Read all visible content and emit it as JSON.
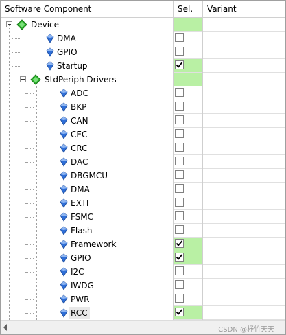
{
  "header": {
    "component": "Software Component",
    "sel": "Sel.",
    "variant": "Variant"
  },
  "rows": [
    {
      "label": "Device",
      "level": 0,
      "type": "group",
      "expander": true,
      "selGreen": true,
      "checkbox": false,
      "checked": false
    },
    {
      "label": "DMA",
      "level": 1,
      "type": "leaf",
      "selGreen": false,
      "checkbox": true,
      "checked": false
    },
    {
      "label": "GPIO",
      "level": 1,
      "type": "leaf",
      "selGreen": false,
      "checkbox": true,
      "checked": false
    },
    {
      "label": "Startup",
      "level": 1,
      "type": "leaf",
      "selGreen": true,
      "checkbox": true,
      "checked": true
    },
    {
      "label": "StdPeriph Drivers",
      "level": 1,
      "type": "group",
      "expander": true,
      "selGreen": true,
      "checkbox": false,
      "checked": false
    },
    {
      "label": "ADC",
      "level": 2,
      "type": "leaf",
      "selGreen": false,
      "checkbox": true,
      "checked": false
    },
    {
      "label": "BKP",
      "level": 2,
      "type": "leaf",
      "selGreen": false,
      "checkbox": true,
      "checked": false
    },
    {
      "label": "CAN",
      "level": 2,
      "type": "leaf",
      "selGreen": false,
      "checkbox": true,
      "checked": false
    },
    {
      "label": "CEC",
      "level": 2,
      "type": "leaf",
      "selGreen": false,
      "checkbox": true,
      "checked": false
    },
    {
      "label": "CRC",
      "level": 2,
      "type": "leaf",
      "selGreen": false,
      "checkbox": true,
      "checked": false
    },
    {
      "label": "DAC",
      "level": 2,
      "type": "leaf",
      "selGreen": false,
      "checkbox": true,
      "checked": false
    },
    {
      "label": "DBGMCU",
      "level": 2,
      "type": "leaf",
      "selGreen": false,
      "checkbox": true,
      "checked": false
    },
    {
      "label": "DMA",
      "level": 2,
      "type": "leaf",
      "selGreen": false,
      "checkbox": true,
      "checked": false
    },
    {
      "label": "EXTI",
      "level": 2,
      "type": "leaf",
      "selGreen": false,
      "checkbox": true,
      "checked": false
    },
    {
      "label": "FSMC",
      "level": 2,
      "type": "leaf",
      "selGreen": false,
      "checkbox": true,
      "checked": false
    },
    {
      "label": "Flash",
      "level": 2,
      "type": "leaf",
      "selGreen": false,
      "checkbox": true,
      "checked": false
    },
    {
      "label": "Framework",
      "level": 2,
      "type": "leaf",
      "selGreen": true,
      "checkbox": true,
      "checked": true
    },
    {
      "label": "GPIO",
      "level": 2,
      "type": "leaf",
      "selGreen": true,
      "checkbox": true,
      "checked": true
    },
    {
      "label": "I2C",
      "level": 2,
      "type": "leaf",
      "selGreen": false,
      "checkbox": true,
      "checked": false
    },
    {
      "label": "IWDG",
      "level": 2,
      "type": "leaf",
      "selGreen": false,
      "checkbox": true,
      "checked": false
    },
    {
      "label": "PWR",
      "level": 2,
      "type": "leaf",
      "selGreen": false,
      "checkbox": true,
      "checked": false
    },
    {
      "label": "RCC",
      "level": 2,
      "type": "leaf",
      "selGreen": true,
      "checkbox": true,
      "checked": true,
      "selected": true
    }
  ],
  "watermark": "CSDN @杼竹天天",
  "colors": {
    "green": "#b9f0a4",
    "diamondGreen": "#2fb52f",
    "gemBlue": "#2f6fd8"
  }
}
